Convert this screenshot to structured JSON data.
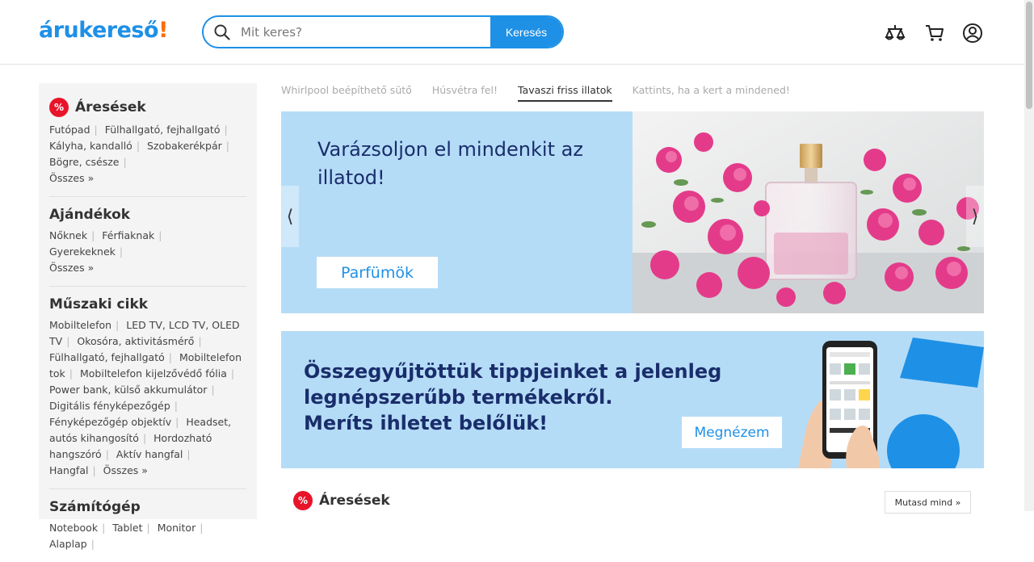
{
  "header": {
    "logo_main": "árukereső",
    "logo_bang": "!",
    "search_placeholder": "Mit keres?",
    "search_button": "Keresés"
  },
  "sidebar": {
    "deals": {
      "title": "Áresések",
      "links": [
        "Futópad",
        "Fülhallgató, fejhallgató",
        "Kályha, kandalló",
        "Szobakerékpár",
        "Bögre, csésze"
      ],
      "all": "Összes »"
    },
    "gifts": {
      "title": "Ajándékok",
      "links": [
        "Nőknek",
        "Férfiaknak",
        "Gyerekeknek"
      ],
      "all": "Összes »"
    },
    "tech": {
      "title": "Műszaki cikk",
      "links": [
        "Mobiltelefon",
        "LED TV, LCD TV, OLED TV",
        "Okosóra, aktivitásmérő",
        "Fülhallgató, fejhallgató",
        "Mobiltelefon tok",
        "Mobiltelefon kijelzővédő fólia",
        "Power bank, külső akkumulátor",
        "Digitális fényképezőgép",
        "Fényképezőgép objektív",
        "Headset, autós kihangosító",
        "Hordozható hangszóró",
        "Aktív hangfal",
        "Hangfal"
      ],
      "all": "Összes »"
    },
    "computers": {
      "title": "Számítógép",
      "links": [
        "Notebook",
        "Tablet",
        "Monitor",
        "Alaplap"
      ]
    }
  },
  "tabs": [
    "Whirlpool beépíthető sütő",
    "Húsvétra fel!",
    "Tavaszi friss illatok",
    "Kattints, ha a kert a mindened!"
  ],
  "active_tab": "Tavaszi friss illatok",
  "banner1": {
    "title": "Varázsoljon el mindenkit az illatod!",
    "button": "Parfümök",
    "arrow_left": "⟨",
    "arrow_right": "⟩"
  },
  "banner2": {
    "line1": "Összegyűjtöttük tippjeinket a jelenleg",
    "line2": "legnépszerűbb termékekről.",
    "line3": "Meríts ihletet belőlük!",
    "button": "Megnézem"
  },
  "deals_section": {
    "title": "Áresések",
    "show_all": "Mutasd mind »"
  },
  "colors": {
    "brand_blue": "#1e90e6",
    "brand_orange": "#ff6a00",
    "deal_red": "#e8142a",
    "banner_bg": "#b5dcf7",
    "banner_text": "#1a2d6b"
  }
}
